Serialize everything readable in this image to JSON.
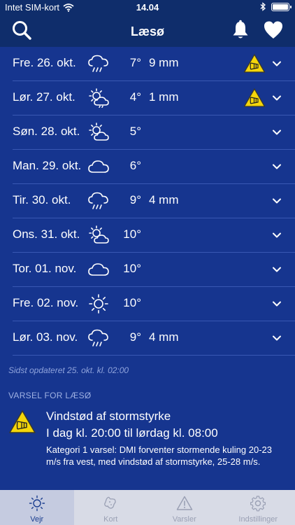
{
  "status_bar": {
    "carrier": "Intet SIM-kort",
    "time": "14.04"
  },
  "nav": {
    "title": "Læsø"
  },
  "forecast": [
    {
      "day": "Fre. 26. okt.",
      "weather_icon": "cloud-rain-icon",
      "temp": "7°",
      "precip": "9 mm",
      "warning": true
    },
    {
      "day": "Lør. 27. okt.",
      "weather_icon": "partly-sunny-rain-icon",
      "temp": "4°",
      "precip": "1 mm",
      "warning": true
    },
    {
      "day": "Søn. 28. okt.",
      "weather_icon": "partly-sunny-icon",
      "temp": "5°",
      "precip": "",
      "warning": false
    },
    {
      "day": "Man. 29. okt.",
      "weather_icon": "cloud-icon",
      "temp": "6°",
      "precip": "",
      "warning": false
    },
    {
      "day": "Tir. 30. okt.",
      "weather_icon": "cloud-rain-icon",
      "temp": "9°",
      "precip": "4 mm",
      "warning": false
    },
    {
      "day": "Ons. 31. okt.",
      "weather_icon": "partly-sunny-icon",
      "temp": "10°",
      "precip": "",
      "warning": false
    },
    {
      "day": "Tor. 01. nov.",
      "weather_icon": "cloud-icon",
      "temp": "10°",
      "precip": "",
      "warning": false
    },
    {
      "day": "Fre. 02. nov.",
      "weather_icon": "sun-icon",
      "temp": "10°",
      "precip": "",
      "warning": false
    },
    {
      "day": "Lør. 03. nov.",
      "weather_icon": "cloud-rain-icon",
      "temp": "9°",
      "precip": "4 mm",
      "warning": false
    }
  ],
  "updated": "Sidst opdateret 25. okt. kl. 02:00",
  "alert": {
    "section_title": "VARSEL FOR LÆSØ",
    "title": "Vindstød af stormstyrke",
    "time": "I dag kl. 20:00 til lørdag kl. 08:00",
    "description": "Kategori 1 varsel: DMI forventer stormende kuling 20-23 m/s fra vest, med vindstød af stormstyrke, 25-28 m/s."
  },
  "tabs": [
    {
      "label": "Vejr",
      "icon": "sun-icon",
      "active": true
    },
    {
      "label": "Kort",
      "icon": "map-icon",
      "active": false
    },
    {
      "label": "Varsler",
      "icon": "warning-icon",
      "active": false
    },
    {
      "label": "Indstillinger",
      "icon": "gear-icon",
      "active": false
    }
  ],
  "colors": {
    "background": "#16358f",
    "header": "#0f2d6b",
    "warning_yellow": "#f5d60a",
    "tabbar": "#d8dbe6",
    "tab_active": "#1a3d8f"
  }
}
